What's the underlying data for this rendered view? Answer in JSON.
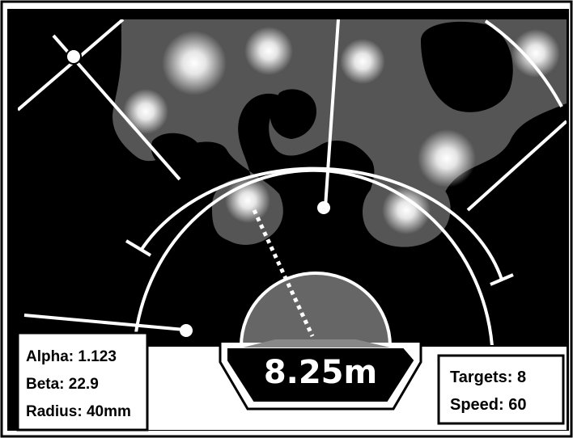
{
  "hud": {
    "distance": "8.25m",
    "left_panel": {
      "alpha": "Alpha: 1.123",
      "beta": "Beta: 22.9",
      "radius": "Radius: 40mm"
    },
    "right_panel": {
      "targets": "Targets: 8",
      "speed": "Speed: 60"
    }
  },
  "colors": {
    "background": "#000000",
    "terrain": "#555555",
    "sensor_dome": "#666666",
    "line": "#ffffff",
    "frame": "#000000"
  },
  "icons": {
    "target_blip": "glowing-blob",
    "waypoint": "white-dot",
    "crosshair": "x-cross"
  }
}
